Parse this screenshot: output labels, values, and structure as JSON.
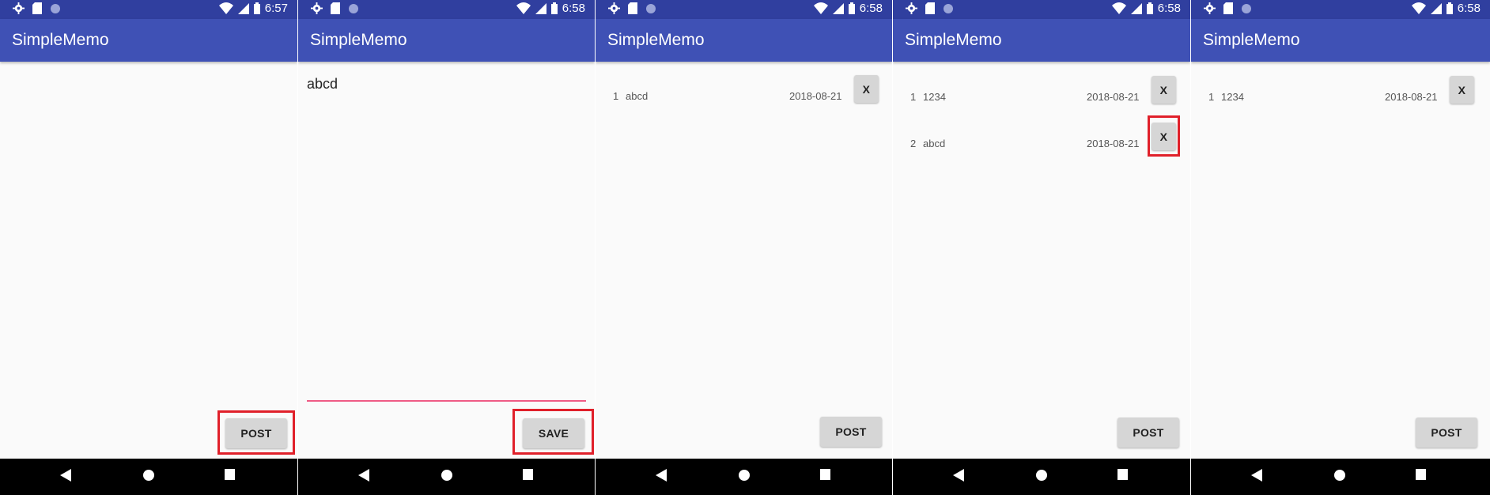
{
  "app": {
    "title": "SimpleMemo"
  },
  "colors": {
    "primary": "#3f51b5",
    "primary_dark": "#303f9f",
    "highlight": "#e0202a",
    "accent_line": "#ef5b85"
  },
  "icons": {
    "status_left": [
      "gear-icon",
      "sd-card-icon",
      "circle-icon"
    ],
    "status_right": [
      "wifi-icon",
      "cell-signal-icon",
      "battery-icon"
    ],
    "nav": [
      "back-icon",
      "home-icon",
      "recents-icon"
    ]
  },
  "screens": [
    {
      "time": "6:57",
      "post_label": "POST"
    },
    {
      "time": "6:58",
      "input_value": "abcd",
      "save_label": "SAVE"
    },
    {
      "time": "6:58",
      "post_label": "POST",
      "memos": [
        {
          "num": "1",
          "text": "abcd",
          "date": "2018-08-21",
          "delete_label": "X"
        }
      ]
    },
    {
      "time": "6:58",
      "post_label": "POST",
      "memos": [
        {
          "num": "1",
          "text": "1234",
          "date": "2018-08-21",
          "delete_label": "X"
        },
        {
          "num": "2",
          "text": "abcd",
          "date": "2018-08-21",
          "delete_label": "X"
        }
      ]
    },
    {
      "time": "6:58",
      "post_label": "POST",
      "memos": [
        {
          "num": "1",
          "text": "1234",
          "date": "2018-08-21",
          "delete_label": "X"
        }
      ]
    }
  ]
}
